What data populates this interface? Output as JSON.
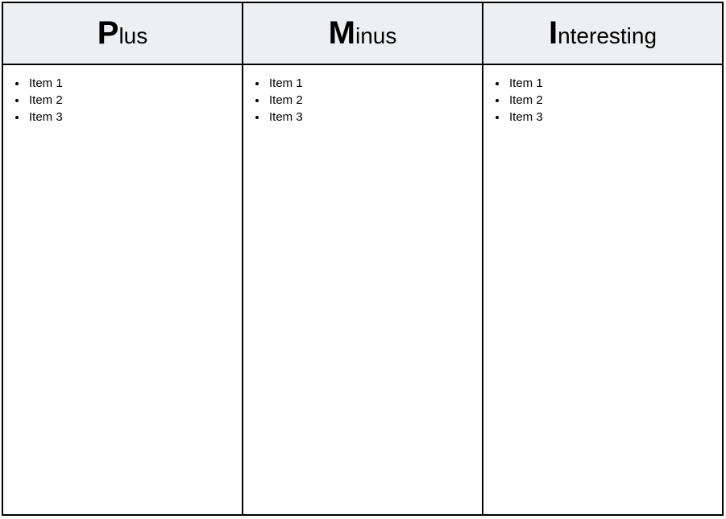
{
  "document": {
    "type": "pmi-table",
    "background_color": "#ffffff",
    "border_color": "#000000",
    "header_background_color": "#eeeff0",
    "text_color": "#000000"
  },
  "table": {
    "columns": [
      {
        "id": "plus",
        "header": {
          "dropcap": "P",
          "rest": "lus",
          "full": "Plus"
        },
        "items": [
          {
            "label": "Item 1"
          },
          {
            "label": "Item 2"
          },
          {
            "label": "Item 3"
          }
        ]
      },
      {
        "id": "minus",
        "header": {
          "dropcap": "M",
          "rest": "inus",
          "full": "Minus"
        },
        "items": [
          {
            "label": "Item 1"
          },
          {
            "label": "Item 2"
          },
          {
            "label": "Item 3"
          }
        ]
      },
      {
        "id": "interesting",
        "header": {
          "dropcap": "I",
          "rest": "nteresting",
          "full": "Interesting"
        },
        "items": [
          {
            "label": "Item 1"
          },
          {
            "label": "Item 2"
          },
          {
            "label": "Item 3"
          }
        ]
      }
    ]
  }
}
